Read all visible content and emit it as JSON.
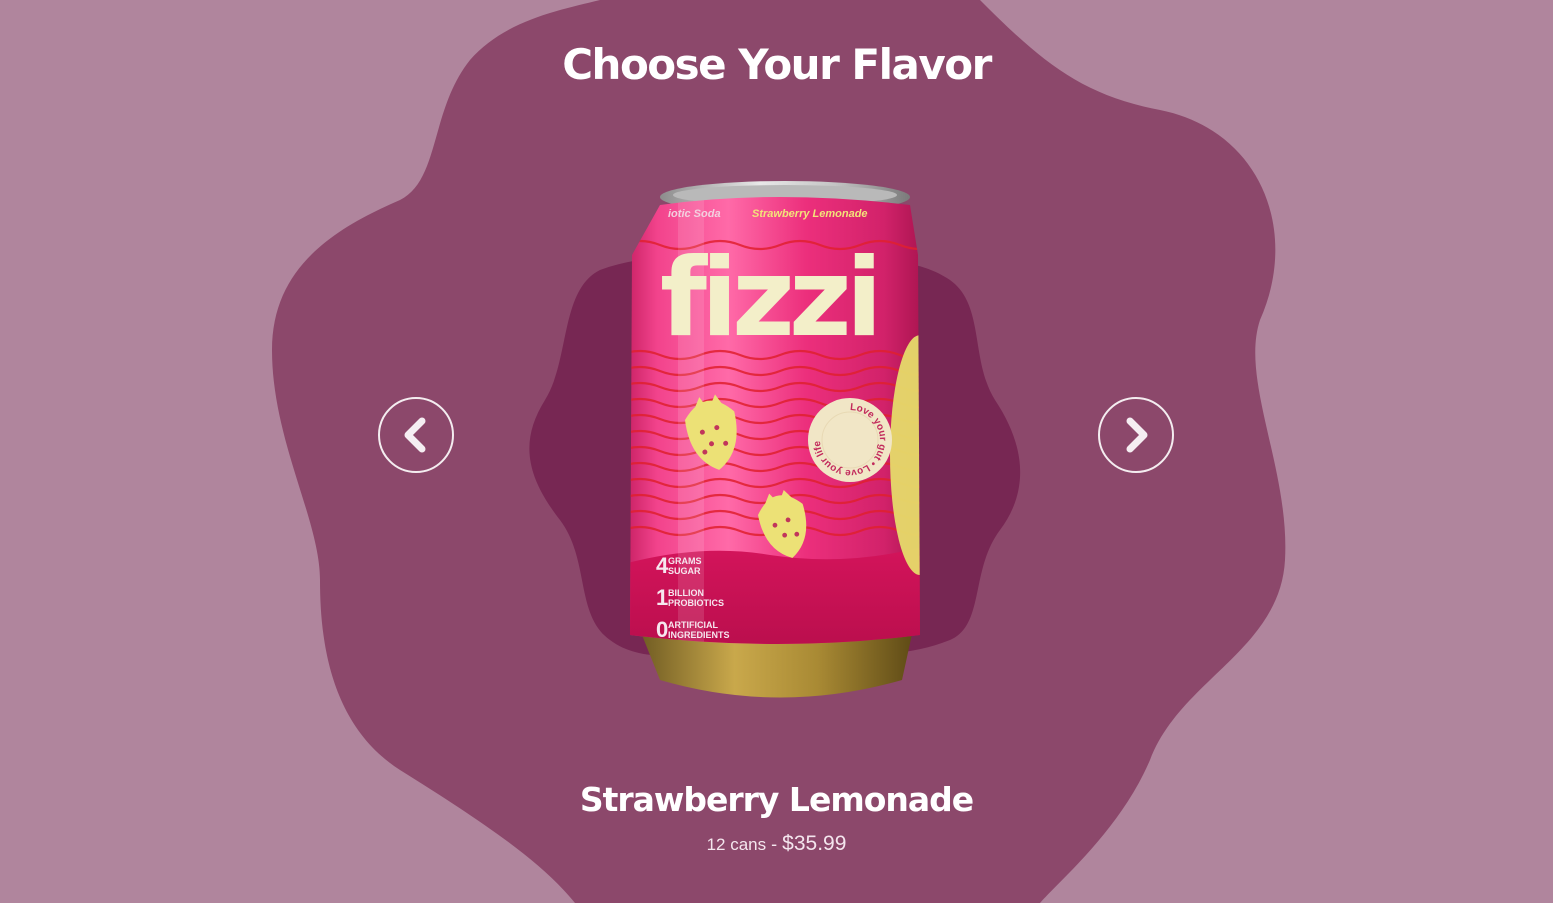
{
  "section": {
    "title": "Choose Your Flavor"
  },
  "carousel": {
    "prev_icon": "chevron-left-icon",
    "next_icon": "chevron-right-icon"
  },
  "product": {
    "name": "Strawberry Lemonade",
    "quantity": "12 cans",
    "separator": "-",
    "price": "$35.99",
    "can": {
      "brand": "fizzi",
      "top_text_left": "iotic Soda",
      "top_text_right": "Strawberry Lemonade",
      "badge_text": "Love your gut • Love your life",
      "facts": [
        {
          "num": "4",
          "line1": "GRAMS",
          "line2": "SUGAR"
        },
        {
          "num": "1",
          "line1": "BILLION",
          "line2": "PROBIOTICS"
        },
        {
          "num": "0",
          "line1": "ARTIFICIAL",
          "line2": "INGREDIENTS"
        }
      ]
    }
  },
  "colors": {
    "page_bg": "#b0859d",
    "blob_outer": "#8c486b",
    "blob_inner": "#772753",
    "can_pink": "#ec2f7c",
    "can_text": "#f3efc9"
  }
}
